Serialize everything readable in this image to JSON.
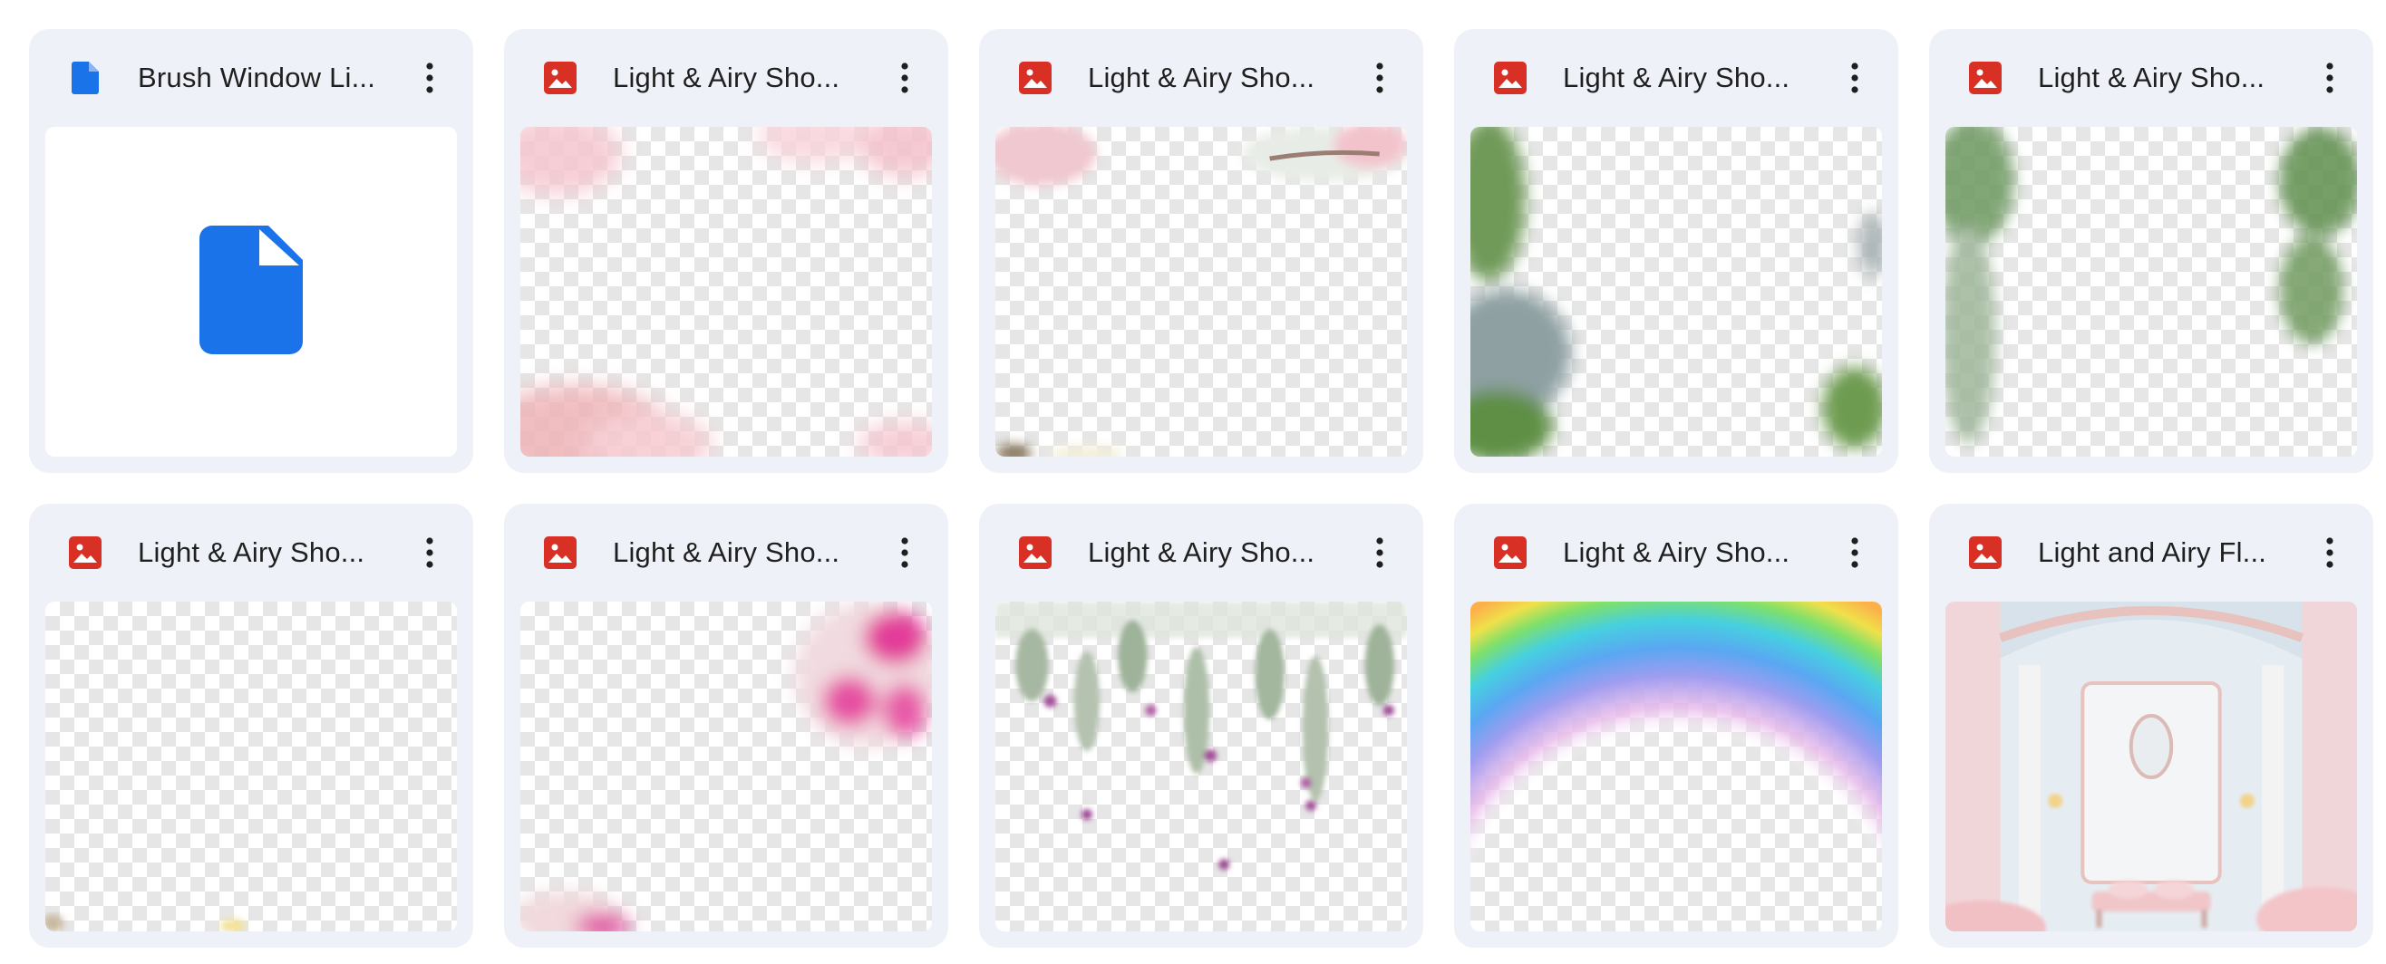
{
  "files": [
    {
      "title": "Brush Window Li...",
      "type_icon": "google-docs-icon",
      "thumbnail": "document-icon"
    },
    {
      "title": "Light & Airy Sho...",
      "type_icon": "image-file-icon",
      "thumbnail": "pink-blossom-corners"
    },
    {
      "title": "Light & Airy Sho...",
      "type_icon": "image-file-icon",
      "thumbnail": "blossom-branch-top"
    },
    {
      "title": "Light & Airy Sho...",
      "type_icon": "image-file-icon",
      "thumbnail": "green-leaves-sides"
    },
    {
      "title": "Light & Airy Sho...",
      "type_icon": "image-file-icon",
      "thumbnail": "green-vines-sides"
    },
    {
      "title": "Light & Airy Sho...",
      "type_icon": "image-file-icon",
      "thumbnail": "mostly-transparent"
    },
    {
      "title": "Light & Airy Sho...",
      "type_icon": "image-file-icon",
      "thumbnail": "magenta-flower-corner"
    },
    {
      "title": "Light & Airy Sho...",
      "type_icon": "image-file-icon",
      "thumbnail": "hanging-wisteria"
    },
    {
      "title": "Light & Airy Sho...",
      "type_icon": "image-file-icon",
      "thumbnail": "rainbow-arc"
    },
    {
      "title": "Light and Airy Fl...",
      "type_icon": "image-file-icon",
      "thumbnail": "pastel-room-interior"
    }
  ],
  "colors": {
    "card_background": "#eef1f8",
    "docs_blue": "#1a73e8",
    "image_red": "#d93025",
    "title_text": "#1f1f1f"
  },
  "more_actions_icon": "more-vert-icon"
}
